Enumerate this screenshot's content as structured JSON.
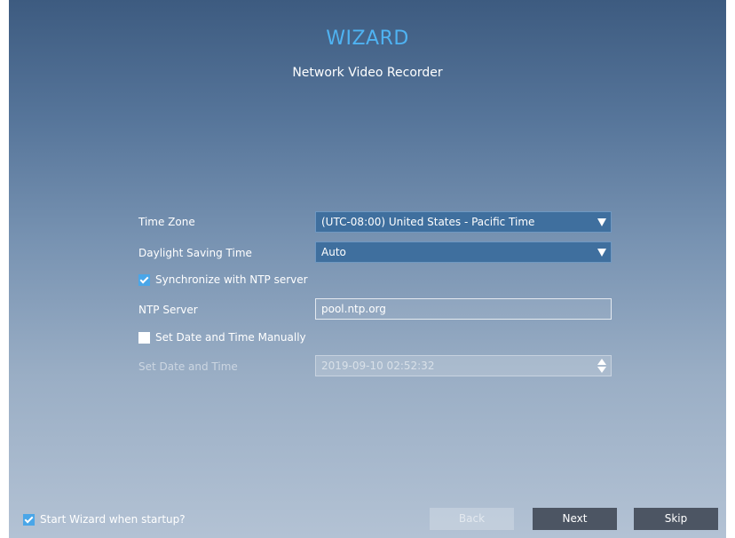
{
  "header": {
    "title": "WIZARD",
    "subtitle": "Network Video Recorder"
  },
  "form": {
    "time_zone": {
      "label": "Time Zone",
      "value": "(UTC-08:00) United States - Pacific Time"
    },
    "dst": {
      "label": "Daylight Saving Time",
      "value": "Auto"
    },
    "ntp_sync": {
      "label": "Synchronize with NTP server",
      "checked": true
    },
    "ntp_server": {
      "label": "NTP Server",
      "value": "pool.ntp.org"
    },
    "manual": {
      "label": "Set Date and Time Manually",
      "checked": false
    },
    "datetime": {
      "label": "Set Date and Time",
      "value": "2019-09-10 02:52:32"
    }
  },
  "footer": {
    "startup_label": "Start Wizard when startup?",
    "startup_checked": true,
    "back": "Back",
    "next": "Next",
    "skip": "Skip"
  },
  "colors": {
    "title": "#4fb3f2",
    "checkbox_checked": "#4aa6e8",
    "select_bg": "#3f6f9e",
    "button_dark": "#4c5563"
  }
}
